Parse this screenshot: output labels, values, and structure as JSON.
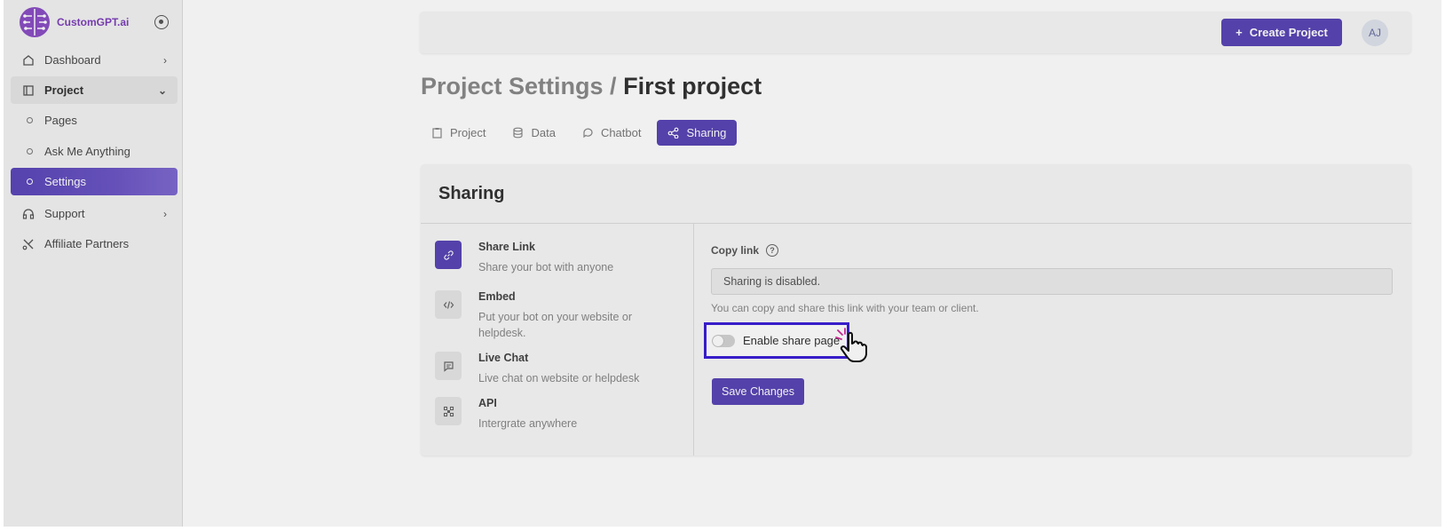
{
  "app": {
    "name": "CustomGPT.ai"
  },
  "sidebar": {
    "items": [
      {
        "label": "Dashboard"
      },
      {
        "label": "Project"
      },
      {
        "label": "Pages"
      },
      {
        "label": "Ask Me Anything"
      },
      {
        "label": "Settings"
      },
      {
        "label": "Support"
      },
      {
        "label": "Affiliate Partners"
      }
    ]
  },
  "header": {
    "create_label": "Create Project",
    "avatar_initials": "AJ"
  },
  "page": {
    "crumb": "Project Settings /",
    "title": "First project"
  },
  "tabs": [
    {
      "label": "Project"
    },
    {
      "label": "Data"
    },
    {
      "label": "Chatbot"
    },
    {
      "label": "Sharing"
    }
  ],
  "sharing": {
    "title": "Sharing",
    "options": [
      {
        "title": "Share Link",
        "desc": "Share your bot with anyone"
      },
      {
        "title": "Embed",
        "desc": "Put your bot on your website or helpdesk."
      },
      {
        "title": "Live Chat",
        "desc": "Live chat on website or helpdesk"
      },
      {
        "title": "API",
        "desc": "Intergrate anywhere"
      }
    ],
    "copy_label": "Copy link",
    "link_value": "Sharing is disabled.",
    "hint": "You can copy and share this link with your team or client.",
    "toggle_label": "Enable share page",
    "toggle_on": false,
    "save_label": "Save Changes"
  },
  "colors": {
    "accent": "#5a46b5",
    "highlight": "#3b1fd6",
    "brand": "#7d3fb8"
  }
}
